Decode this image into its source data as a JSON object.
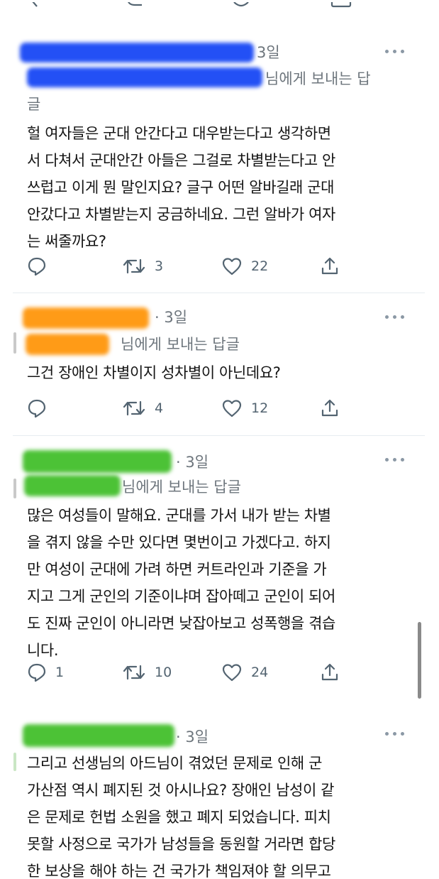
{
  "tweets": [
    {
      "time": "3일",
      "reply_prefix": "님에게 보내는 답",
      "reply_wrap": "글",
      "body": [
        "헐 여자들은 군대 안간다고 대우받는다고 생각하면",
        "서 다쳐서 군대안간 아들은 그걸로 차별받는다고 안",
        "쓰럽고 이게 뭔 말인지요? 글구 어떤 알바길래 군대",
        "안갔다고 차별받는지 궁금하네요. 그런 알바가 여자",
        "는 써줄까요?"
      ],
      "replies": "",
      "retweets": "3",
      "likes": "22"
    },
    {
      "time": "· 3일",
      "reply_to": "님에게 보내는 답글",
      "body": [
        "그건 장애인 차별이지 성차별이 아닌데요?"
      ],
      "replies": "",
      "retweets": "4",
      "likes": "12"
    },
    {
      "time": "· 3일",
      "reply_to": "님에게 보내는 답글",
      "body": [
        "많은 여성들이 말해요. 군대를 가서 내가 받는 차별",
        "을 겪지 않을 수만 있다면 몇번이고 가겠다고. 하지",
        "만 여성이 군대에 가려 하면 커트라인과 기준을 가",
        "지고 그게 군인의 기준이냐며 잡아떼고 군인이 되어",
        "도 진짜 군인이 아니라면 낮잡아보고 성폭행을 겪습",
        "니다."
      ],
      "replies": "1",
      "retweets": "10",
      "likes": "24"
    },
    {
      "time": "· 3일",
      "body": [
        "그리고 선생님의 아드님이 겪었던 문제로 인해 군",
        "가산점 역시 폐지된 것 아시나요? 장애인 남성이 같",
        "은 문제로 헌법 소원을 했고 폐지 되었습니다. 피치",
        "못할 사정으로 국가가 남성들을 동원할 거라면 합당",
        "한 보상을 해야 하는 건 국가가 책임져야 할 의무고"
      ]
    }
  ],
  "colors": {
    "redact_blue": "#2350f5",
    "redact_orange": "#ff9b17",
    "redact_green": "#4cc236",
    "accent": "#1d9bf0"
  },
  "icons": [
    "reply-icon",
    "retweet-icon",
    "like-icon",
    "share-icon",
    "more-icon"
  ]
}
